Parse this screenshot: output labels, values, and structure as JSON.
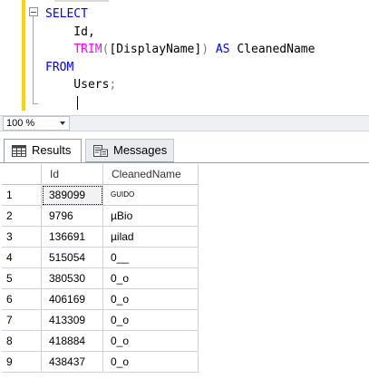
{
  "editor": {
    "lines": [
      [
        {
          "t": "SELECT",
          "c": "kw"
        }
      ],
      [
        {
          "t": "    Id,",
          "c": "tx"
        }
      ],
      [
        {
          "t": "    ",
          "c": "tx"
        },
        {
          "t": "TRIM",
          "c": "fn"
        },
        {
          "t": "(",
          "c": "gr"
        },
        {
          "t": "[DisplayName]",
          "c": "tx"
        },
        {
          "t": ")",
          "c": "gr"
        },
        {
          "t": " ",
          "c": "tx"
        },
        {
          "t": "AS",
          "c": "kw"
        },
        {
          "t": " CleanedName",
          "c": "tx"
        }
      ],
      [
        {
          "t": "FROM",
          "c": "kw"
        }
      ],
      [
        {
          "t": "    Users",
          "c": "tx"
        },
        {
          "t": ";",
          "c": "gr"
        }
      ],
      [
        {
          "t": "",
          "c": "tx"
        }
      ]
    ]
  },
  "zoom": {
    "value": "100 %"
  },
  "tabs": {
    "results": "Results",
    "messages": "Messages"
  },
  "grid": {
    "columns": [
      "Id",
      "CleanedName"
    ],
    "rows": [
      {
        "n": "1",
        "id": "389099",
        "name": "GUIDO"
      },
      {
        "n": "2",
        "id": "9796",
        "name": "µBio"
      },
      {
        "n": "3",
        "id": "136691",
        "name": "µilad"
      },
      {
        "n": "4",
        "id": "515054",
        "name": "0__"
      },
      {
        "n": "5",
        "id": "380530",
        "name": "0_o"
      },
      {
        "n": "6",
        "id": "406169",
        "name": "0_o"
      },
      {
        "n": "7",
        "id": "413309",
        "name": "0_o"
      },
      {
        "n": "8",
        "id": "418884",
        "name": "0_o"
      },
      {
        "n": "9",
        "id": "438437",
        "name": "0_o"
      }
    ]
  }
}
